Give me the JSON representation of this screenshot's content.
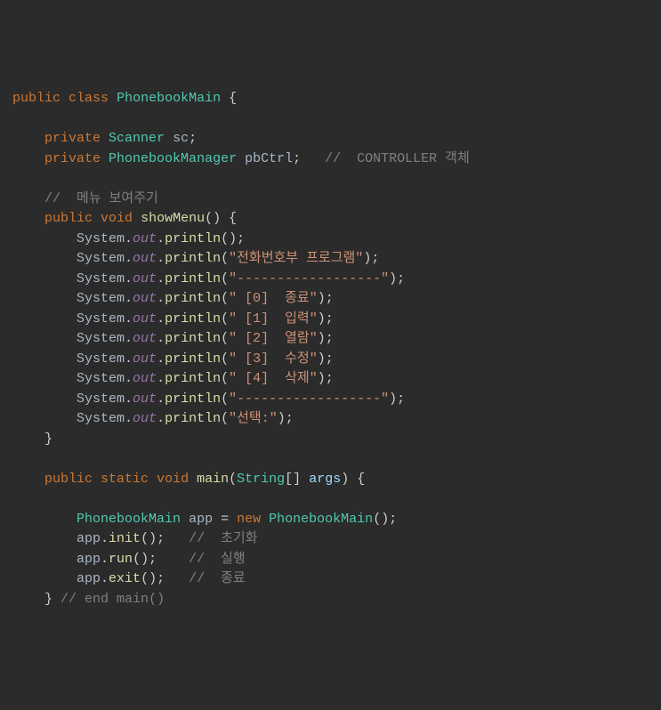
{
  "code": {
    "line1": {
      "kw1": "public",
      "kw2": "class",
      "className": "PhonebookMain",
      "brace": "{"
    },
    "line2": "",
    "line3": {
      "kw": "private",
      "type": "Scanner",
      "var": "sc",
      "sc": ";"
    },
    "line4": {
      "kw": "private",
      "type": "PhonebookManager",
      "var": "pbCtrl",
      "sc": ";",
      "cmt": "//  CONTROLLER 객체"
    },
    "line5": "",
    "line6": {
      "cmt": "//  메뉴 보여주기"
    },
    "line7": {
      "kw1": "public",
      "kw2": "void",
      "method": "showMenu",
      "parens": "()",
      "brace": "{"
    },
    "println_calls": [
      {
        "obj": "System",
        "out": "out",
        "method": "println",
        "args": "()",
        "sc": ";"
      },
      {
        "obj": "System",
        "out": "out",
        "method": "println",
        "lp": "(",
        "str": "\"전화번호부 프로그램\"",
        "rp": ")",
        "sc": ";"
      },
      {
        "obj": "System",
        "out": "out",
        "method": "println",
        "lp": "(",
        "str": "\"------------------\"",
        "rp": ")",
        "sc": ";"
      },
      {
        "obj": "System",
        "out": "out",
        "method": "println",
        "lp": "(",
        "str": "\" [0]  종료\"",
        "rp": ")",
        "sc": ";"
      },
      {
        "obj": "System",
        "out": "out",
        "method": "println",
        "lp": "(",
        "str": "\" [1]  입력\"",
        "rp": ")",
        "sc": ";"
      },
      {
        "obj": "System",
        "out": "out",
        "method": "println",
        "lp": "(",
        "str": "\" [2]  열람\"",
        "rp": ")",
        "sc": ";"
      },
      {
        "obj": "System",
        "out": "out",
        "method": "println",
        "lp": "(",
        "str": "\" [3]  수정\"",
        "rp": ")",
        "sc": ";"
      },
      {
        "obj": "System",
        "out": "out",
        "method": "println",
        "lp": "(",
        "str": "\" [4]  삭제\"",
        "rp": ")",
        "sc": ";"
      },
      {
        "obj": "System",
        "out": "out",
        "method": "println",
        "lp": "(",
        "str": "\"------------------\"",
        "rp": ")",
        "sc": ";"
      },
      {
        "obj": "System",
        "out": "out",
        "method": "println",
        "lp": "(",
        "str": "\"선택:\"",
        "rp": ")",
        "sc": ";"
      }
    ],
    "line18": {
      "brace": "}"
    },
    "line19": "",
    "line20": {
      "kw1": "public",
      "kw2": "static",
      "kw3": "void",
      "method": "main",
      "lp": "(",
      "ptype": "String",
      "brackets": "[]",
      "param": "args",
      "rp": ")",
      "brace": "{"
    },
    "line21": "",
    "line22": {
      "type": "PhonebookMain",
      "var": "app",
      "eq": "=",
      "kw": "new",
      "ctor": "PhonebookMain",
      "parens": "()",
      "sc": ";"
    },
    "line23": {
      "var": "app",
      "dot": ".",
      "method": "init",
      "parens": "()",
      "sc": ";",
      "cmt": "//  초기화"
    },
    "line24": {
      "var": "app",
      "dot": ".",
      "method": "run",
      "parens": "()",
      "sc": ";",
      "cmt": "//  실행"
    },
    "line25": {
      "var": "app",
      "dot": ".",
      "method": "exit",
      "parens": "()",
      "sc": ";",
      "cmt": "//  종료"
    },
    "line26": {
      "brace": "}",
      "cmt": "// end main()"
    }
  }
}
